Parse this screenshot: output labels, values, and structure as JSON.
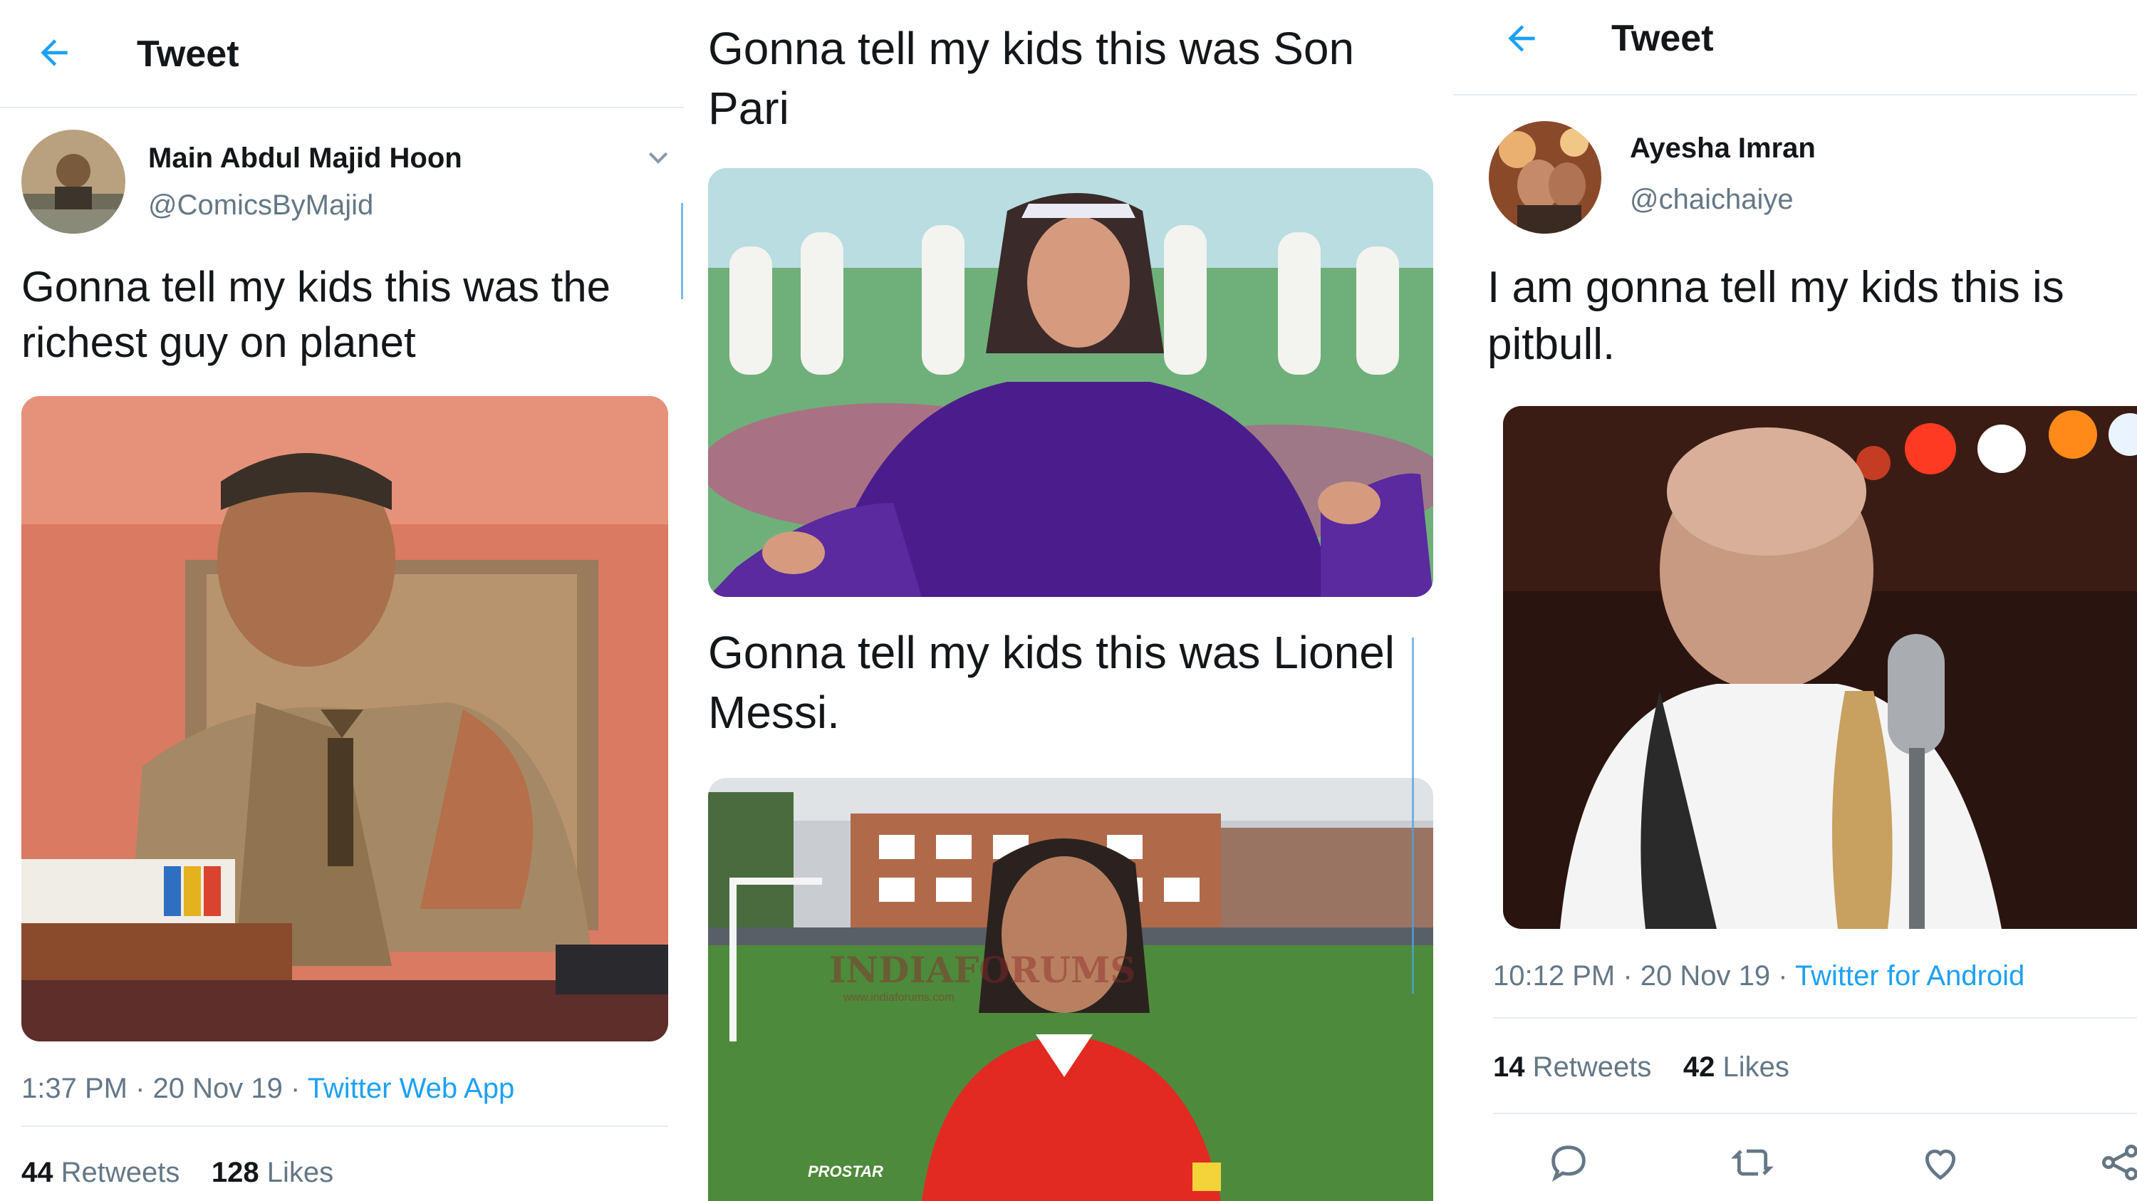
{
  "colors": {
    "accent": "#1da1f2",
    "text": "#14171a",
    "muted": "#657786",
    "divider": "#e6ecf0"
  },
  "tweet1": {
    "header_title": "Tweet",
    "back_icon": "arrow-left-icon",
    "author_name": "Main Abdul Majid Hoon",
    "author_handle": "@ComicsByMajid",
    "menu_icon": "chevron-down-icon",
    "text": "Gonna tell my kids this was the richest guy on planet",
    "time": "1:37 PM",
    "date": "20 Nov 19",
    "source": "Twitter Web App",
    "retweets_count": "44",
    "retweets_label": "Retweets",
    "likes_count": "128",
    "likes_label": "Likes"
  },
  "tweet2": {
    "text": "Gonna tell my kids this was Son Pari"
  },
  "tweet3": {
    "text": "Gonna tell my kids this was Lionel Messi."
  },
  "tweet4": {
    "header_title": "Tweet",
    "back_icon": "arrow-left-icon",
    "author_name": "Ayesha Imran",
    "author_handle": "@chaichaiye",
    "text": "I am gonna tell my kids this is pitbull.",
    "time": "10:12 PM",
    "date": "20 Nov 19",
    "source": "Twitter for Android",
    "retweets_count": "14",
    "retweets_label": "Retweets",
    "likes_count": "42",
    "likes_label": "Likes",
    "actions": [
      "reply-icon",
      "retweet-icon",
      "like-icon",
      "share-icon"
    ]
  },
  "watermark": {
    "logo_text": "INDIAFORUMS",
    "site": "www.indiaforums.com",
    "jersey_text": "PROSTAR"
  }
}
